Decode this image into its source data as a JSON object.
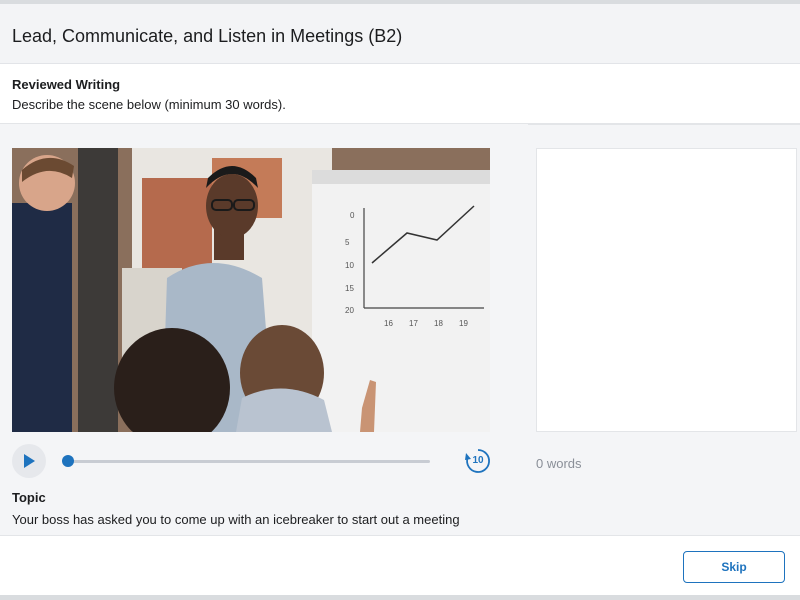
{
  "header": {
    "title": "Lead, Communicate, and Listen in Meetings (B2)"
  },
  "task": {
    "label": "Reviewed Writing",
    "instruction": "Describe the scene below (minimum 30 words)."
  },
  "media": {
    "description_icon": "video-frame",
    "play_icon": "play-icon",
    "replay_seconds": "10",
    "progress": 0
  },
  "topic": {
    "label": "Topic",
    "text": "Your boss has asked you to come up with an icebreaker to start out a meeting"
  },
  "answer": {
    "value": "",
    "word_count": "0 words"
  },
  "footer": {
    "skip_label": "Skip"
  },
  "colors": {
    "accent": "#1e73be",
    "header_bg": "#f3f4f6",
    "work_bg": "#f4f5f7"
  }
}
